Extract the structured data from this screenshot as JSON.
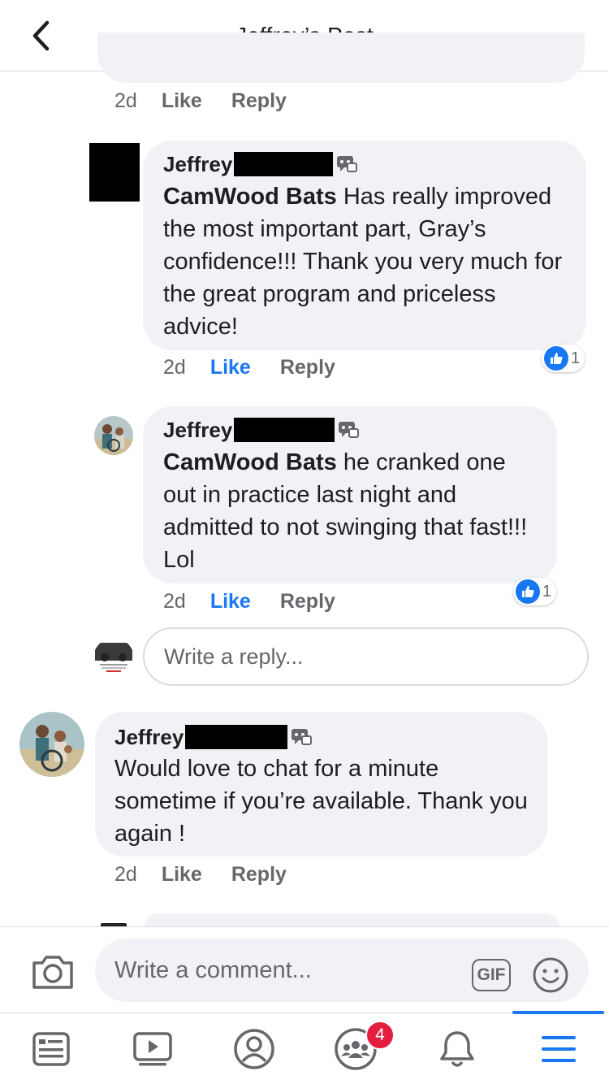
{
  "header": {
    "title": "Jeffrey’s Post"
  },
  "top_actions": {
    "time": "2d",
    "like": "Like",
    "reply": "Reply"
  },
  "comments": [
    {
      "author": "Jeffrey",
      "mention": "CamWood Bats",
      "text": " Has really improved the most important part, Gray’s confidence!!! Thank you very much for the great program and priceless advice!",
      "time": "2d",
      "like": "Like",
      "reply": "Reply",
      "reaction_count": "1",
      "liked": true
    },
    {
      "author": "Jeffrey",
      "mention": "CamWood Bats",
      "text": " he cranked one out in practice last night and admitted to not swinging that fast!!! Lol",
      "time": "2d",
      "like": "Like",
      "reply": "Reply",
      "reaction_count": "1",
      "liked": true
    },
    {
      "author": "Jeffrey",
      "text": "Would love to chat for a minute sometime if you’re available. Thank you again !",
      "time": "2d",
      "like": "Like",
      "reply": "Reply",
      "liked": false
    }
  ],
  "reply_box": {
    "placeholder": "Write a reply..."
  },
  "comment_bar": {
    "placeholder": "Write a comment...",
    "gif_label": "GIF"
  },
  "tabbar": {
    "groups_badge": "4",
    "active_tab": "menu"
  },
  "colors": {
    "accent": "#1877f2",
    "bubble": "#f0f2f5",
    "secondary_text": "#65676b",
    "badge": "#e41e3f"
  },
  "icons": [
    "back-icon",
    "more-icon",
    "edited-icon",
    "like-reaction-icon",
    "camera-icon",
    "gif-icon",
    "emoji-icon",
    "news-feed-icon",
    "watch-icon",
    "profile-icon",
    "groups-icon",
    "notifications-icon",
    "menu-icon"
  ]
}
